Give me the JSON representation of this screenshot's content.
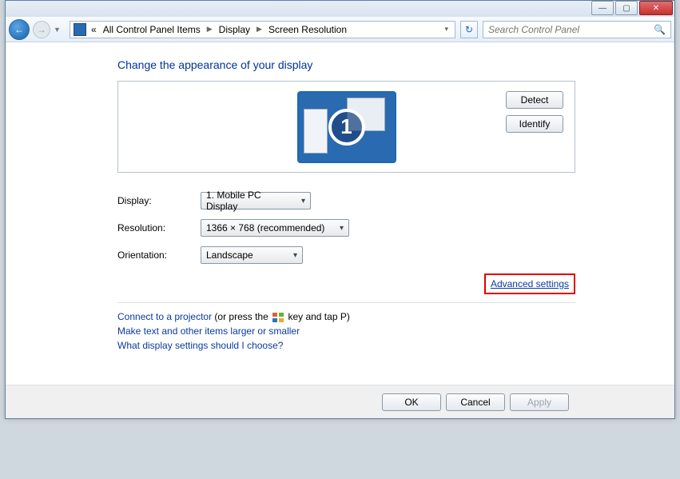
{
  "window": {
    "min_icon": "—",
    "max_icon": "▢",
    "close_icon": "✕"
  },
  "nav": {
    "back_arrow": "←",
    "fwd_arrow": "→",
    "breadcrumb_prefix": "«",
    "crumb1": "All Control Panel Items",
    "crumb2": "Display",
    "crumb3": "Screen Resolution",
    "search_placeholder": "Search Control Panel",
    "refresh_icon": "↻"
  },
  "page": {
    "heading": "Change the appearance of your display",
    "detect_btn": "Detect",
    "identify_btn": "Identify",
    "monitor_number": "1",
    "fields": {
      "display_label": "Display:",
      "display_value": "1. Mobile PC Display",
      "resolution_label": "Resolution:",
      "resolution_value": "1366 × 768 (recommended)",
      "orientation_label": "Orientation:",
      "orientation_value": "Landscape"
    },
    "advanced_link": "Advanced settings",
    "projector_link": "Connect to a projector",
    "projector_after1": " (or press the ",
    "projector_after2": " key and tap P)",
    "textsize_link": "Make text and other items larger or smaller",
    "help_link": "What display settings should I choose?"
  },
  "footer": {
    "ok": "OK",
    "cancel": "Cancel",
    "apply": "Apply"
  }
}
